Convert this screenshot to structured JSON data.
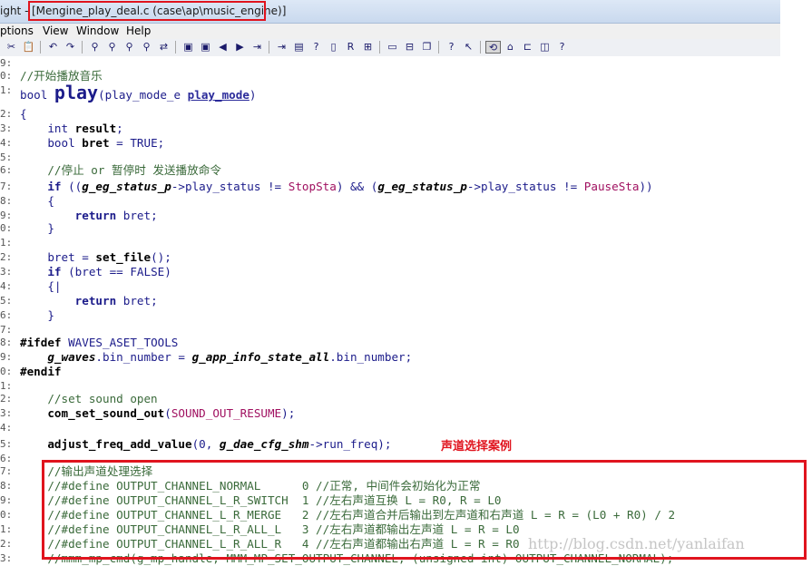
{
  "window": {
    "app_name_fragment": "ight - ",
    "doc_title": "[Mengine_play_deal.c (case\\ap\\music_engine)]"
  },
  "menu": [
    "ptions",
    "View",
    "Window",
    "Help"
  ],
  "toolbar_icons": [
    "cut-icon",
    "paste-icon",
    "undo-icon",
    "redo-icon",
    "find-icon",
    "find-next-icon",
    "find-prev-icon",
    "find-files-icon",
    "replace-icon",
    "bookmark-icon",
    "bookmark-next-icon",
    "back-icon",
    "forward-icon",
    "jump-icon",
    "jump-next-icon",
    "symbol-window-icon",
    "browse-icon",
    "book-icon",
    "relation-icon",
    "window-tile-icon",
    "window-single-icon",
    "window-split-icon",
    "window-cascade-icon",
    "lookup-icon",
    "help-cursor-icon",
    "sync-icon",
    "context-icon",
    "tree-icon",
    "layout-icon",
    "info-icon"
  ],
  "code_lines": [
    {
      "ln": "9:",
      "html": ""
    },
    {
      "ln": "0:",
      "segments": [
        [
          "cm",
          "//开始播放音乐"
        ]
      ]
    },
    {
      "ln": "1:",
      "segments": [
        [
          "type",
          "bool "
        ],
        [
          "bigfn",
          "play"
        ],
        [
          "type",
          "(play_mode_e "
        ],
        [
          "ul",
          "play_mode"
        ],
        [
          "type",
          ")"
        ]
      ]
    },
    {
      "ln": "2:",
      "segments": [
        [
          "type",
          "{"
        ]
      ]
    },
    {
      "ln": "3:",
      "segments": [
        [
          "type",
          "    int "
        ],
        [
          "fn",
          "result"
        ],
        [
          "type",
          ";"
        ]
      ]
    },
    {
      "ln": "4:",
      "segments": [
        [
          "type",
          "    bool "
        ],
        [
          "fn",
          "bret"
        ],
        [
          "type",
          " = TRUE;"
        ]
      ]
    },
    {
      "ln": "5:",
      "segments": []
    },
    {
      "ln": "6:",
      "segments": [
        [
          "cm",
          "    //停止 or 暂停时 发送播放命令"
        ]
      ]
    },
    {
      "ln": "7:",
      "segments": [
        [
          "kw",
          "    if "
        ],
        [
          "type",
          "(("
        ],
        [
          "gv",
          "g_eg_status_p"
        ],
        [
          "type",
          "->play_status != "
        ],
        [
          "str",
          "StopSta"
        ],
        [
          "type",
          ") && ("
        ],
        [
          "gv",
          "g_eg_status_p"
        ],
        [
          "type",
          "->play_status != "
        ],
        [
          "str",
          "PauseSta"
        ],
        [
          "type",
          "))"
        ]
      ]
    },
    {
      "ln": "8:",
      "segments": [
        [
          "type",
          "    {"
        ]
      ]
    },
    {
      "ln": "9:",
      "segments": [
        [
          "kw",
          "        return "
        ],
        [
          "type",
          "bret;"
        ]
      ]
    },
    {
      "ln": "0:",
      "segments": [
        [
          "type",
          "    }"
        ]
      ]
    },
    {
      "ln": "1:",
      "segments": []
    },
    {
      "ln": "2:",
      "segments": [
        [
          "type",
          "    bret = "
        ],
        [
          "fn",
          "set_file"
        ],
        [
          "type",
          "();"
        ]
      ]
    },
    {
      "ln": "3:",
      "segments": [
        [
          "kw",
          "    if "
        ],
        [
          "type",
          "(bret == FALSE)"
        ]
      ]
    },
    {
      "ln": "4:",
      "segments": [
        [
          "type",
          "    {|"
        ]
      ]
    },
    {
      "ln": "5:",
      "segments": [
        [
          "kw",
          "        return "
        ],
        [
          "type",
          "bret;"
        ]
      ]
    },
    {
      "ln": "6:",
      "segments": [
        [
          "type",
          "    }"
        ]
      ]
    },
    {
      "ln": "7:",
      "segments": []
    },
    {
      "ln": "8:",
      "segments": [
        [
          "pp",
          "#ifdef "
        ],
        [
          "type",
          "WAVES_ASET_TOOLS"
        ]
      ]
    },
    {
      "ln": "9:",
      "segments": [
        [
          "gv",
          "    g_waves"
        ],
        [
          "type",
          ".bin_number = "
        ],
        [
          "gv",
          "g_app_info_state_all"
        ],
        [
          "type",
          ".bin_number;"
        ]
      ]
    },
    {
      "ln": "0:",
      "segments": [
        [
          "pp",
          "#endif"
        ]
      ]
    },
    {
      "ln": "1:",
      "segments": []
    },
    {
      "ln": "2:",
      "segments": [
        [
          "cm",
          "    //set sound open"
        ]
      ]
    },
    {
      "ln": "3:",
      "segments": [
        [
          "fn",
          "    com_set_sound_out"
        ],
        [
          "type",
          "("
        ],
        [
          "str",
          "SOUND_OUT_RESUME"
        ],
        [
          "type",
          ");"
        ]
      ]
    },
    {
      "ln": "4:",
      "segments": []
    },
    {
      "ln": "5:",
      "segments": [
        [
          "fn",
          "    adjust_freq_add_value"
        ],
        [
          "type",
          "(0, "
        ],
        [
          "gv",
          "g_dae_cfg_shm"
        ],
        [
          "type",
          "->run_freq);"
        ]
      ]
    },
    {
      "ln": "6:",
      "segments": []
    },
    {
      "ln": "7:",
      "segments": [
        [
          "cm",
          "    //输出声道处理选择"
        ]
      ]
    },
    {
      "ln": "8:",
      "segments": [
        [
          "cm",
          "    //#define OUTPUT_CHANNEL_NORMAL      0 //正常, 中间件会初始化为正常"
        ]
      ]
    },
    {
      "ln": "9:",
      "segments": [
        [
          "cm",
          "    //#define OUTPUT_CHANNEL_L_R_SWITCH  1 //左右声道互换 L = R0, R = L0"
        ]
      ]
    },
    {
      "ln": "0:",
      "segments": [
        [
          "cm",
          "    //#define OUTPUT_CHANNEL_L_R_MERGE   2 //左右声道合并后输出到左声道和右声道 L = R = (L0 + R0) / 2"
        ]
      ]
    },
    {
      "ln": "1:",
      "segments": [
        [
          "cm",
          "    //#define OUTPUT_CHANNEL_L_R_ALL_L   3 //左右声道都输出左声道 L = R = L0"
        ]
      ]
    },
    {
      "ln": "2:",
      "segments": [
        [
          "cm",
          "    //#define OUTPUT_CHANNEL_L_R_ALL_R   4 //左右声道都输出右声道 L = R = R0"
        ]
      ]
    },
    {
      "ln": "3:",
      "segments": [
        [
          "cm",
          "    //mmm_mp_cmd(g_mp_handle, MMM_MP_SET_OUTPUT_CHANNEL, (unsigned int) OUTPUT_CHANNEL_NORMAL);"
        ]
      ]
    }
  ],
  "annotation": "声道选择案例",
  "watermark": "http://blog.csdn.net/yanlaifan",
  "colors": {
    "highlight_red": "#e0141e"
  }
}
